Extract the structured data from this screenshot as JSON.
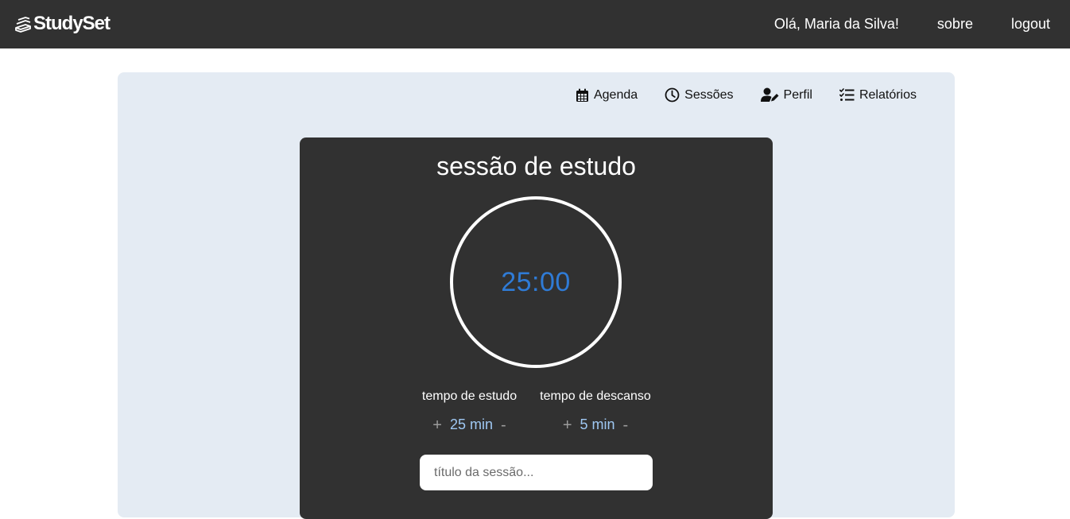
{
  "header": {
    "logo_text": "StudySet",
    "greeting": "Olá, Maria da Silva!",
    "about_link": "sobre",
    "logout_link": "logout"
  },
  "nav": {
    "items": [
      {
        "label": "Agenda",
        "icon": "calendar-icon"
      },
      {
        "label": "Sessões",
        "icon": "clock-icon"
      },
      {
        "label": "Perfil",
        "icon": "user-edit-icon"
      },
      {
        "label": "Relatórios",
        "icon": "list-check-icon"
      }
    ]
  },
  "session": {
    "title": "sessão de estudo",
    "timer": "25:00",
    "study": {
      "label": "tempo de estudo",
      "value": "25 min",
      "plus": "+",
      "minus": "-"
    },
    "rest": {
      "label": "tempo de descanso",
      "value": "5 min",
      "plus": "+",
      "minus": "-"
    },
    "title_placeholder": "título da sessão..."
  },
  "colors": {
    "topbar": "#313131",
    "panel": "#e4ebf3",
    "card": "#313131",
    "timer_text": "#2f7bd6",
    "step_value": "#9fc8f3"
  }
}
